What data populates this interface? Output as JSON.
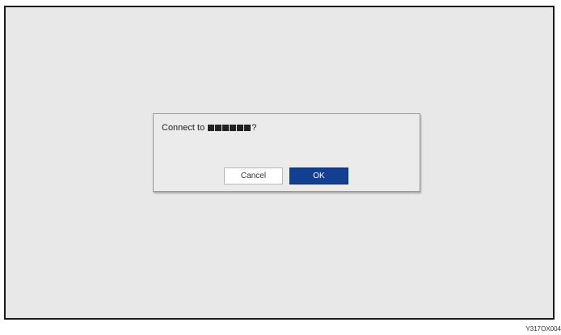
{
  "dialog": {
    "message_prefix": "Connect to ",
    "masked_name_blocks": 6,
    "message_suffix": "?",
    "cancel_label": "Cancel",
    "ok_label": "OK"
  },
  "figure_code": "Y317OX004",
  "colors": {
    "screen_background": "#e8e8e8",
    "ok_button": "#123f8f",
    "cancel_button": "#ffffff"
  }
}
